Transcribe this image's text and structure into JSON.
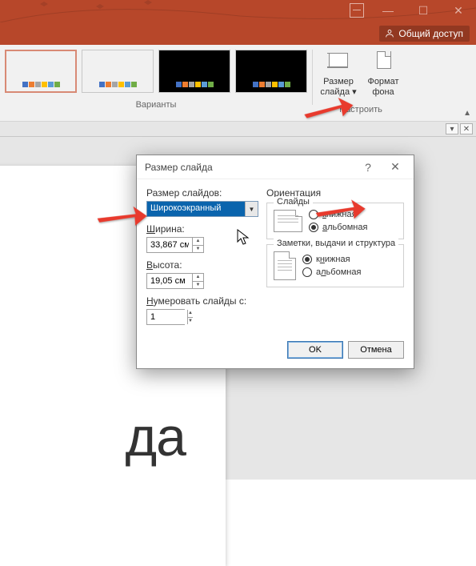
{
  "titlebar": {},
  "sharebar": {
    "share_label": "Общий доступ"
  },
  "ribbon": {
    "variants_label": "Варианты",
    "configure_label": "Настроить",
    "size_btn": "Размер слайда",
    "format_btn": "Формат фона"
  },
  "slide": {
    "partial_text": "да"
  },
  "dialog": {
    "title": "Размер слайда",
    "size_label": "Размер слайдов:",
    "size_value": "Широкоэкранный",
    "width_label": "Ширина:",
    "width_value": "33,867 см",
    "height_label": "Высота:",
    "height_value": "19,05 см",
    "number_label": "Нумеровать слайды с:",
    "number_value": "1",
    "orientation_label": "Ориентация",
    "slides_group": "Слайды",
    "notes_group": "Заметки, выдачи и структура",
    "portrait": "книжная",
    "landscape": "альбомная",
    "ok": "OK",
    "cancel": "Отмена"
  }
}
